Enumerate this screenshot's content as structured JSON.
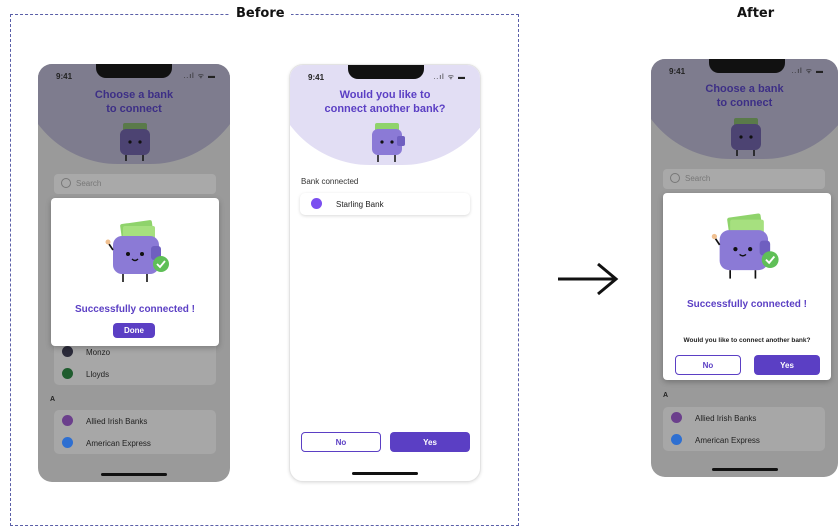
{
  "labels": {
    "before": "Before",
    "after": "After"
  },
  "status": {
    "time": "9:41",
    "signal": "..ıl ᯤ ▬"
  },
  "screen_choose": {
    "title_line1": "Choose a bank",
    "title_line2": "to connect",
    "search_placeholder": "Search",
    "modal": {
      "message": "Successfully connected !",
      "done_label": "Done"
    },
    "list_top": [
      {
        "name": "Monzo",
        "color": "#2b2b3a"
      },
      {
        "name": "Lloyds",
        "color": "#1f5c2e"
      }
    ],
    "section_a": "A",
    "list_a": [
      {
        "name": "Allied Irish Banks",
        "color": "#6b3f8c"
      },
      {
        "name": "American Express",
        "color": "#2e6fd1"
      }
    ]
  },
  "screen_connected": {
    "title_line1": "Would you like to",
    "title_line2": "connect another bank?",
    "bank_connected_label": "Bank connected",
    "bank_name": "Starling Bank",
    "no_label": "No",
    "yes_label": "Yes"
  },
  "screen_after": {
    "title_line1": "Choose a bank",
    "title_line2": "to connect",
    "search_placeholder": "Search",
    "modal": {
      "message": "Successfully connected !",
      "question": "Would you like to connect another bank?",
      "no_label": "No",
      "yes_label": "Yes"
    },
    "section_a": "A",
    "list_a": [
      {
        "name": "Allied Irish Banks",
        "color": "#6b3f8c"
      },
      {
        "name": "American Express",
        "color": "#2e6fd1"
      }
    ]
  },
  "colors": {
    "accent": "#5b3fc4",
    "frame": "#5a5fa8",
    "money": "#8fd36b",
    "wallet": "#8b7ad6"
  }
}
